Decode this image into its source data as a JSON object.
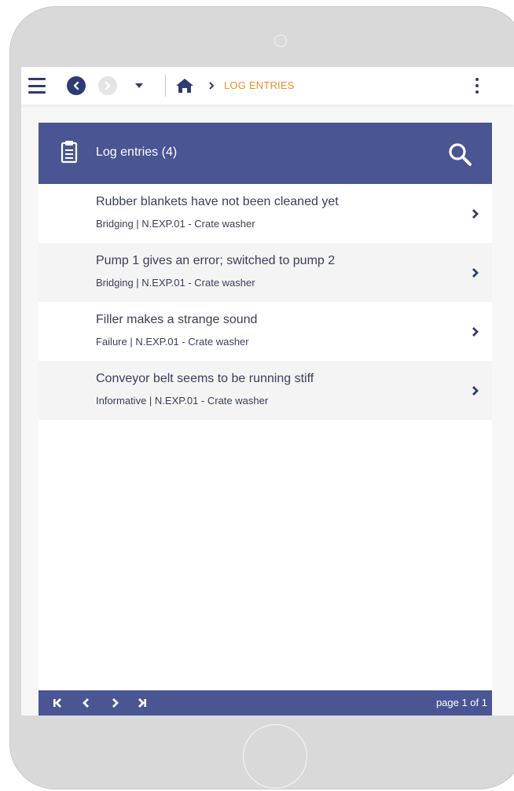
{
  "toolbar": {
    "breadcrumb_current": "LOG ENTRIES"
  },
  "panel": {
    "title": "Log entries (4)"
  },
  "entries": [
    {
      "title": "Rubber blankets have not been cleaned yet",
      "subtitle": "Bridging | N.EXP.01 - Crate washer"
    },
    {
      "title": "Pump 1 gives an error; switched to pump 2",
      "subtitle": "Bridging | N.EXP.01 - Crate washer"
    },
    {
      "title": "Filler makes a strange sound",
      "subtitle": "Failure | N.EXP.01 - Crate washer"
    },
    {
      "title": "Conveyor belt seems to be running stiff",
      "subtitle": "Informative | N.EXP.01 - Crate washer"
    }
  ],
  "pager": {
    "text": "page 1 of 1"
  },
  "icons": {
    "menu": "hamburger-menu-icon",
    "back": "nav-back-icon",
    "forward": "nav-forward-icon",
    "dropdown": "caret-down-icon",
    "home": "home-icon",
    "breadcrumb_separator": "chevron-right-icon",
    "more": "kebab-menu-icon",
    "panel": "clipboard-icon",
    "search": "search-icon",
    "row": "chevron-right-icon",
    "first": "first-page-icon",
    "prev": "previous-page-icon",
    "next": "next-page-icon",
    "last": "last-page-icon"
  },
  "colors": {
    "primary": "#4a5594",
    "nav_dark": "#2f3b73",
    "accent": "#f28c28"
  }
}
